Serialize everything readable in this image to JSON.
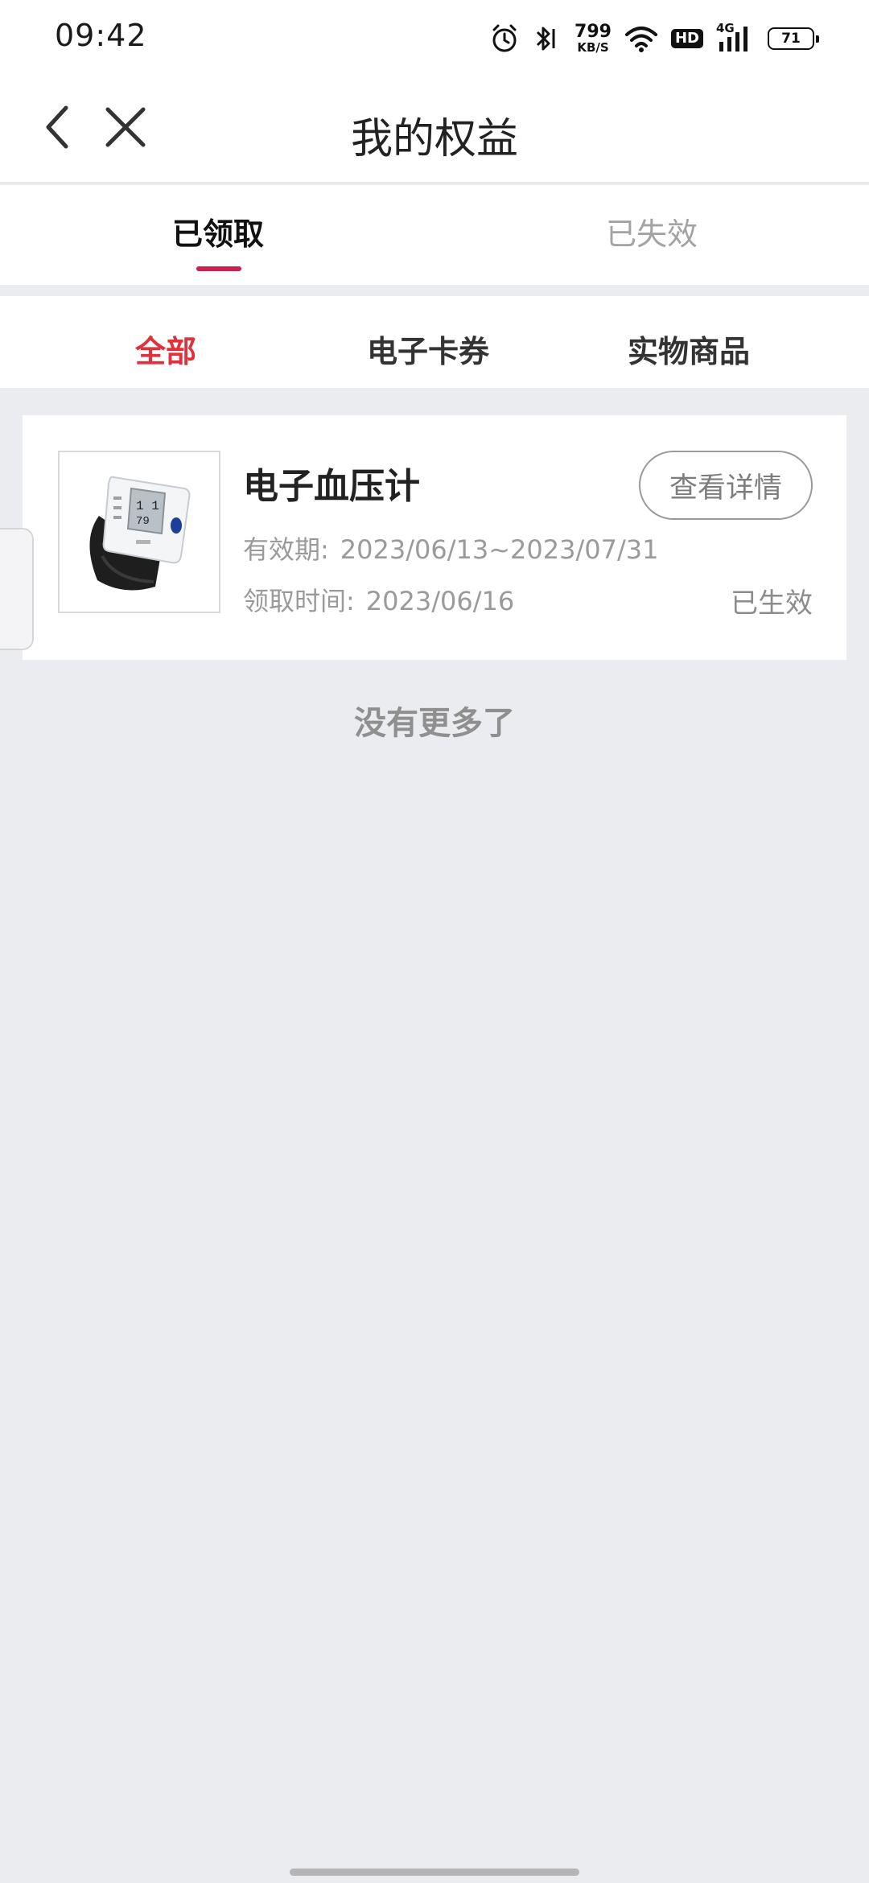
{
  "status_bar": {
    "time": "09:42",
    "net_speed_value": "799",
    "net_speed_unit": "KB/S",
    "hd_label": "HD",
    "network_type": "4G",
    "battery_level": "71",
    "icons": [
      "alarm-icon",
      "bluetooth-icon",
      "wifi-icon",
      "hd-icon",
      "signal-icon",
      "battery-icon"
    ]
  },
  "header": {
    "title": "我的权益",
    "back_icon": "chevron-left-icon",
    "close_icon": "close-icon"
  },
  "tabs": [
    {
      "label": "已领取",
      "active": true
    },
    {
      "label": "已失效",
      "active": false
    }
  ],
  "sub_tabs": [
    {
      "label": "全部",
      "active": true
    },
    {
      "label": "电子卡券",
      "active": false
    },
    {
      "label": "实物商品",
      "active": false
    }
  ],
  "items": [
    {
      "name": "电子血压计",
      "detail_button": "查看详情",
      "valid_label": "有效期:",
      "valid_value": "2023/06/13~2023/07/31",
      "claim_label": "领取时间:",
      "claim_value": "2023/06/16",
      "status": "已生效",
      "image_icon": "blood-pressure-monitor-image"
    }
  ],
  "footer_text": "没有更多了",
  "colors": {
    "accent_red": "#e0323c",
    "tab_indicator": "#cc1f4e",
    "background": "#ebecf0"
  }
}
